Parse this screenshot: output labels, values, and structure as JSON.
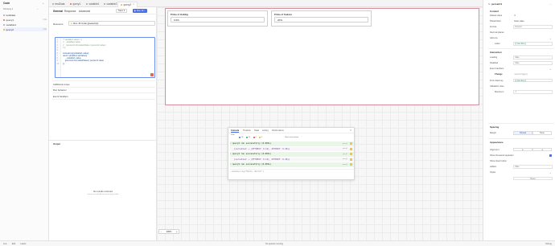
{
  "tabs": [
    {
      "label": "testData",
      "color": "#9aa7b8"
    },
    {
      "label": "query1",
      "color": "#e8664b"
    },
    {
      "label": "variable1",
      "color": "#9aa7b8"
    },
    {
      "label": "variable2",
      "color": "#9aa7b8"
    },
    {
      "label": "query2",
      "color": "#f0b429",
      "active": true
    }
  ],
  "left_panel": {
    "title": "Code",
    "filter": "Showing 4",
    "items": [
      {
        "name": "testData",
        "meta": "",
        "color": "#9aa7b8"
      },
      {
        "name": "query1",
        "meta": "2.0s",
        "color": "#e8664b"
      },
      {
        "name": "variable1",
        "meta": "",
        "color": "#9aa7b8"
      },
      {
        "name": "query2",
        "meta": "1.0s",
        "color": "#f0b429"
      }
    ]
  },
  "editor": {
    "tab_general": "General",
    "tab_response": "Response",
    "tab_advanced": "Advanced",
    "save_label": "Save",
    "run_label": "Run",
    "run_shortcut": "⌘↵",
    "resource_label": "Resource",
    "resource_value": "Run JS Code (javascript)",
    "code": [
      {
        "no": "1",
        "text": "/* variable1.value = {",
        "kind": "comment"
      },
      {
        "no": "2",
        "text": "//    variable1.value,",
        "kind": "comment"
      },
      {
        "no": "3",
        "text": "//    (percent1.formattedValue / percent1.value)",
        "kind": "comment"
      },
      {
        "no": "4",
        "text": "// };",
        "kind": "comment"
      },
      {
        "no": "5",
        "text": "",
        "kind": "code"
      },
      {
        "no": "6",
        "text": "console.log(variable1.value);",
        "kind": "code"
      },
      {
        "no": "7",
        "text": "return variable1.setValue({",
        "kind": "code"
      },
      {
        "no": "8",
        "text": "    ...variable1.value,",
        "kind": "code"
      },
      {
        "no": "9",
        "text": "    [percent1.formattedValue]: percent1.value",
        "kind": "code"
      },
      {
        "no": "10",
        "text": "});",
        "kind": "code"
      }
    ],
    "section_scope": "Additional scope",
    "section_run_behavior": "Run behavior",
    "section_event_handlers": "Event handlers",
    "output_label": "Output",
    "empty_title": "No results returned",
    "empty_sub": "Query ran and did not return any results"
  },
  "canvas": {
    "card1_title": "Prime of Holiday",
    "card1_value": "0.0%",
    "card2_title": "Prime of Sodexo",
    "card2_value": "20%",
    "zoom": "100%",
    "zoom_minus": "−",
    "zoom_plus": "+"
  },
  "console": {
    "tabs": [
      "Console",
      "Timeline",
      "State",
      "Linting",
      "Performance"
    ],
    "filter_label": "Filter",
    "counts": [
      {
        "label": "18",
        "color": "#4b6fe6"
      },
      {
        "label": "52",
        "color": "#38a169"
      },
      {
        "label": "0",
        "color": "#e53e3e"
      },
      {
        "label": "0",
        "color": "#f0b429"
      }
    ],
    "show_timestamps": "Show timestamps",
    "rows": [
      {
        "kind": "success",
        "text": "✓ query2 ran successfully (0.003s)",
        "time": "query2"
      },
      {
        "kind": "data",
        "text": "{variable1: ▸ {PFTOMAT: 0.12}, OPTPORT: 0.20}}",
        "time": "query2"
      },
      {
        "kind": "success",
        "text": "✓ query2 ran successfully (0.003s)",
        "time": "query2"
      },
      {
        "kind": "data",
        "text": "{variable1: ▸ {PFTOMAT: 0.12}, OPTPORT: 0.20}}",
        "time": "query2"
      },
      {
        "kind": "success",
        "text": "✓ query2 ran successfully (0.003s)",
        "time": "query2"
      }
    ],
    "input": "console.log(\"Hello, World!\")"
  },
  "right_panel": {
    "component": "percent1",
    "section_content": "Content",
    "default_value_label": "Default value",
    "default_value": "0",
    "placeholder_label": "Placeholder",
    "placeholder_value": "Enter value",
    "format_label": "Format",
    "format_value": "Percent",
    "decimal_label": "Decimal places",
    "add_ons_label": "Add-ons",
    "label_label": "Label",
    "label_value": "{{ item.title }}",
    "section_interaction": "Interaction",
    "loading_label": "Loading",
    "loading_value": "false",
    "disabled_label": "Disabled",
    "disabled_value": "false",
    "event_handlers_label": "Event handlers",
    "change_label": "Change",
    "change_value": "query2.trigger()",
    "form_key_label": "Form data key",
    "form_key_value": "{{ item.key }}",
    "validation_label": "Validation rules",
    "maximum_label": "Maximum",
    "maximum_value": "1",
    "section_spacing": "Spacing",
    "margin_label": "Margin",
    "margin_normal": "Normal",
    "margin_none": "None",
    "section_appearance": "Appearance",
    "alignment_label": "Alignment",
    "show_sep_label": "Show thousand separator",
    "show_clear_label": "Show clear button",
    "hidden_label": "Hidden",
    "hidden_value": "false",
    "styles_label": "Styles",
    "styles_value": "Reset"
  },
  "status": {
    "left_items": [
      "Live",
      "Edit",
      "Latest"
    ],
    "center": "No queries running",
    "right": "Debug"
  }
}
